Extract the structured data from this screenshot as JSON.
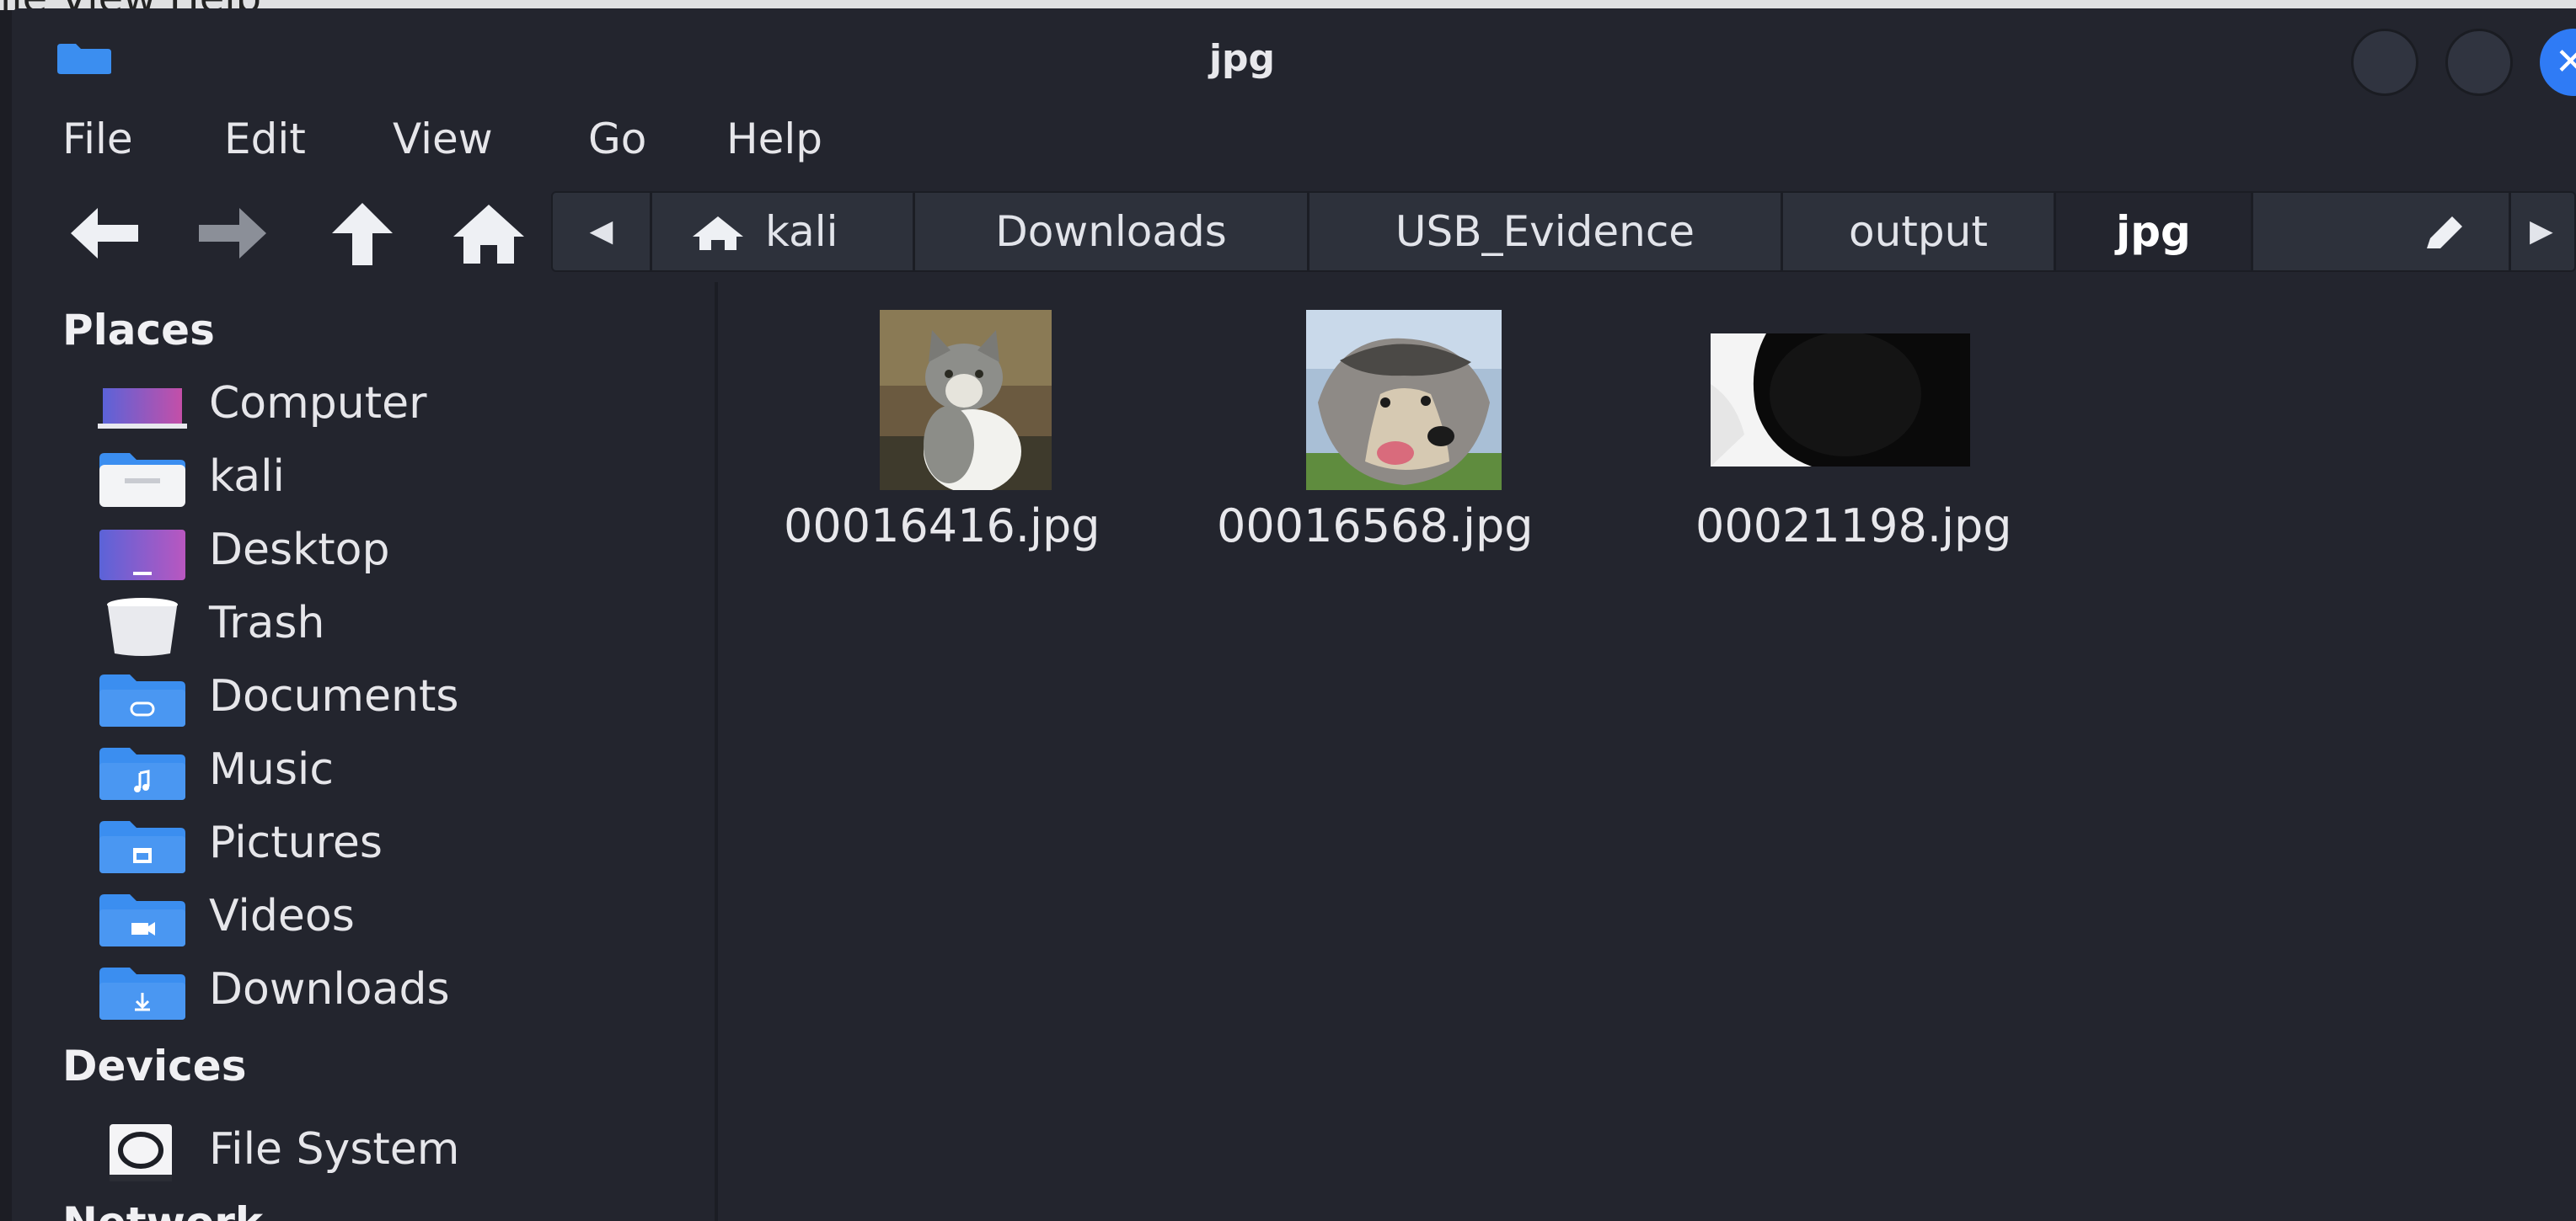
{
  "background_text": "ile View Help",
  "window": {
    "title": "jpg",
    "accent_color": "#2f7bf5",
    "background_color": "#23252e"
  },
  "menu": [
    "File",
    "Edit",
    "View",
    "Go",
    "Help"
  ],
  "toolbar": {
    "back_icon": "arrow-left-icon",
    "forward_icon": "arrow-right-icon",
    "up_icon": "arrow-up-icon",
    "home_icon": "home-icon"
  },
  "path": {
    "segments": [
      "kali",
      "Downloads",
      "USB_Evidence",
      "output",
      "jpg"
    ],
    "active": "jpg",
    "edit_icon": "pencil-icon"
  },
  "sidebar": {
    "places_title": "Places",
    "places": [
      {
        "label": "Computer",
        "icon": "computer-icon"
      },
      {
        "label": "kali",
        "icon": "home-folder-icon"
      },
      {
        "label": "Desktop",
        "icon": "desktop-icon"
      },
      {
        "label": "Trash",
        "icon": "trash-icon"
      },
      {
        "label": "Documents",
        "icon": "documents-folder-icon"
      },
      {
        "label": "Music",
        "icon": "music-folder-icon"
      },
      {
        "label": "Pictures",
        "icon": "pictures-folder-icon"
      },
      {
        "label": "Videos",
        "icon": "videos-folder-icon"
      },
      {
        "label": "Downloads",
        "icon": "downloads-folder-icon"
      }
    ],
    "devices_title": "Devices",
    "devices": [
      {
        "label": "File System",
        "icon": "drive-icon"
      }
    ],
    "network_title": "Network"
  },
  "files": [
    {
      "name": "00016416.jpg",
      "thumbnail": "cat-thumbnail"
    },
    {
      "name": "00016568.jpg",
      "thumbnail": "dog-thumbnail"
    },
    {
      "name": "00021198.jpg",
      "thumbnail": "dark-image-thumbnail"
    }
  ]
}
